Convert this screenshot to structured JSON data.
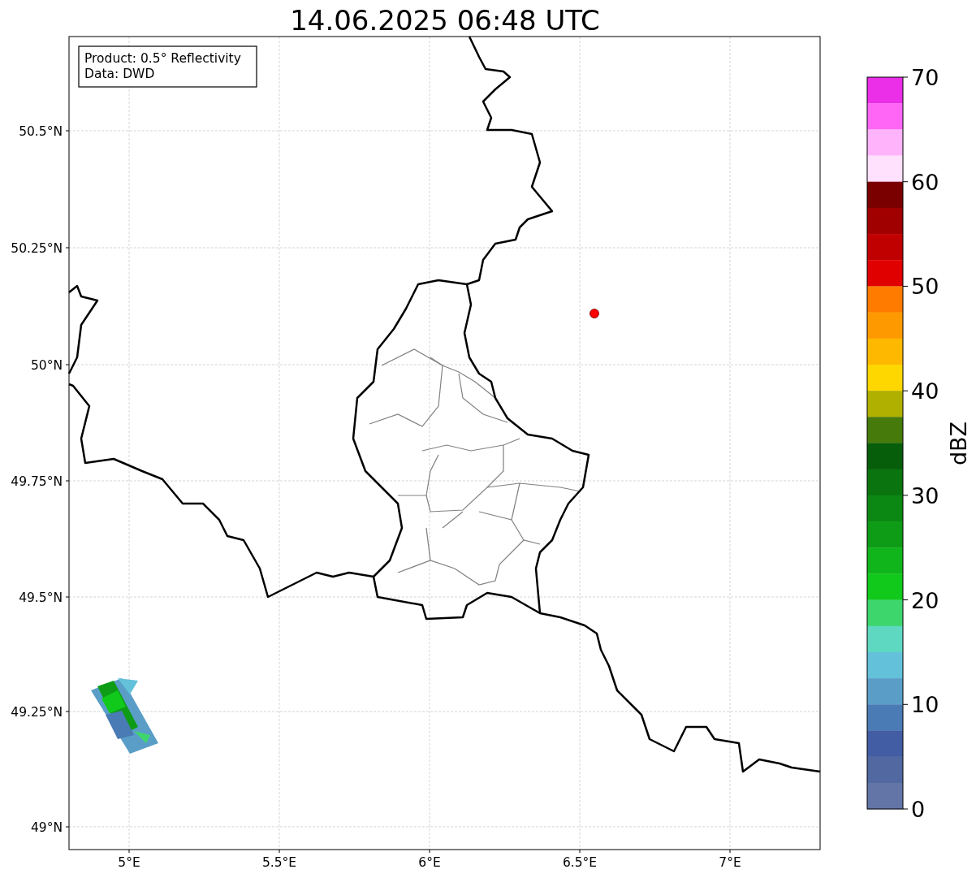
{
  "title": "14.06.2025 06:48 UTC",
  "legend": [
    "Product: 0.5° Reflectivity",
    "Data: DWD"
  ],
  "x_ticks": [
    "5°E",
    "5.5°E",
    "6°E",
    "6.5°E",
    "7°E"
  ],
  "y_ticks": [
    "50.5°N",
    "50.25°N",
    "50°N",
    "49.75°N",
    "49.5°N",
    "49.25°N",
    "49°N"
  ],
  "colorbar": {
    "label": "dBZ",
    "ticks": [
      "70",
      "60",
      "50",
      "40",
      "30",
      "20",
      "10",
      "0"
    ],
    "bins": [
      {
        "color": "#eb2ee8"
      },
      {
        "color": "#ff66f5"
      },
      {
        "color": "#ffb3fb"
      },
      {
        "color": "#ffe0fd"
      },
      {
        "color": "#7a0000"
      },
      {
        "color": "#a00000"
      },
      {
        "color": "#c00000"
      },
      {
        "color": "#e00000"
      },
      {
        "color": "#ff7b00"
      },
      {
        "color": "#ff9900"
      },
      {
        "color": "#ffb800"
      },
      {
        "color": "#ffd700"
      },
      {
        "color": "#afb000"
      },
      {
        "color": "#467a0a"
      },
      {
        "color": "#075e0a"
      },
      {
        "color": "#0a740f"
      },
      {
        "color": "#0b8813"
      },
      {
        "color": "#0e9c16"
      },
      {
        "color": "#10b41b"
      },
      {
        "color": "#10c91b"
      },
      {
        "color": "#3dd66d"
      },
      {
        "color": "#5fd8c2"
      },
      {
        "color": "#63c1da"
      },
      {
        "color": "#5a9ec7"
      },
      {
        "color": "#4a7bb5"
      },
      {
        "color": "#425da3"
      },
      {
        "color": "#5168a0"
      },
      {
        "color": "#6375a6"
      }
    ]
  }
}
